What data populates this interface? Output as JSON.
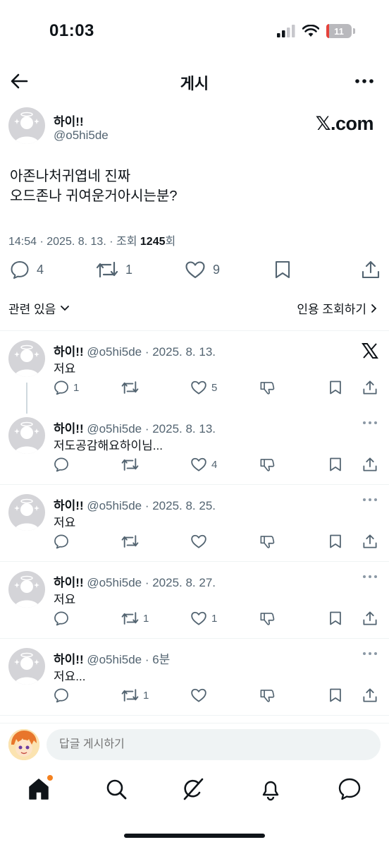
{
  "status": {
    "time": "01:03",
    "battery": "11"
  },
  "header": {
    "title": "게시"
  },
  "post": {
    "name": "하이!!",
    "handle": "@o5hi5de",
    "brand": "𝕏.com",
    "lines": [
      "아존나처귀엽네 진짜",
      "오드존나 귀여운거아시는분?"
    ],
    "meta_prefix": "14:54 · 2025. 8. 13. · 조회 ",
    "views": "1245",
    "meta_suffix": "회",
    "stats": {
      "replies": "4",
      "reposts": "1",
      "likes": "9"
    },
    "related_label": "관련 있음",
    "quotes_label": "인용 조회하기"
  },
  "replies": [
    {
      "name": "하이!!",
      "meta": "@o5hi5de · 2025. 8. 13.",
      "text": "저요",
      "replies": "1",
      "reposts": "",
      "likes": "5"
    },
    {
      "name": "하이!!",
      "meta": "@o5hi5de · 2025. 8. 13.",
      "text": "저도공감해요하이님...",
      "replies": "",
      "reposts": "",
      "likes": "4"
    },
    {
      "name": "하이!!",
      "meta": "@o5hi5de · 2025. 8. 25.",
      "text": "저요",
      "replies": "",
      "reposts": "",
      "likes": ""
    },
    {
      "name": "하이!!",
      "meta": "@o5hi5de · 2025. 8. 27.",
      "text": "저요",
      "replies": "",
      "reposts": "1",
      "likes": "1"
    },
    {
      "name": "하이!!",
      "meta": "@o5hi5de · 6분",
      "text": "저요...",
      "replies": "",
      "reposts": "1",
      "likes": ""
    }
  ],
  "compose": {
    "placeholder": "답글 게시하기"
  },
  "icons": {
    "back": "arrow-left-icon",
    "more": "more-icon",
    "reply": "comment-icon",
    "repost": "repost-icon",
    "like": "heart-icon",
    "bookmark": "bookmark-icon",
    "share": "share-icon",
    "downvote": "downvote-icon",
    "home": "home-icon",
    "search": "search-icon",
    "grok": "grok-icon",
    "notifications": "bell-icon",
    "messages": "message-icon"
  },
  "colors": {
    "text": "#0f1419",
    "muted": "#536471",
    "badge": "#f4811f"
  }
}
